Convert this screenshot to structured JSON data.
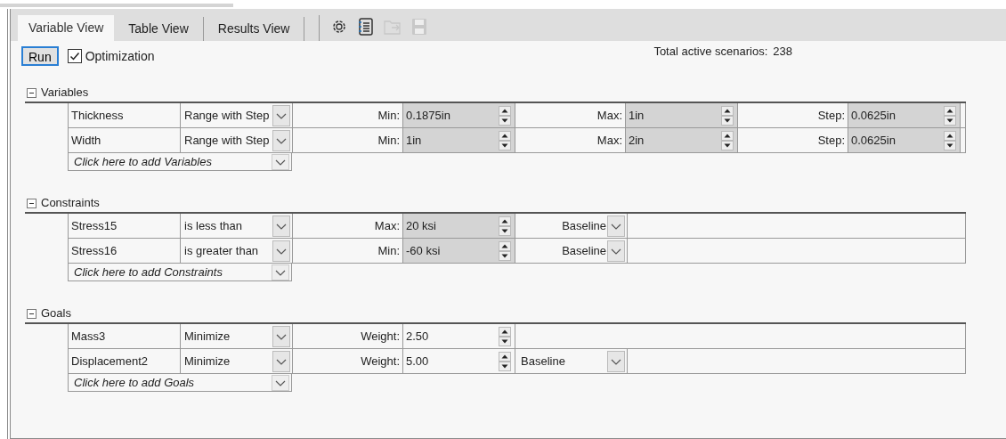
{
  "tabs": [
    {
      "label": "Variable View",
      "selected": true
    },
    {
      "label": "Table View",
      "selected": false
    },
    {
      "label": "Results View",
      "selected": false
    }
  ],
  "toolbar": [
    {
      "kind": "settings",
      "disabled": false
    },
    {
      "kind": "notebook",
      "disabled": false
    },
    {
      "kind": "folder",
      "disabled": true
    },
    {
      "kind": "save",
      "disabled": true
    }
  ],
  "run_button": {
    "label": "Run",
    "focused": true
  },
  "optimization": {
    "label": "Optimization",
    "checked": true
  },
  "total": {
    "label": "Total active scenarios:",
    "value": "238"
  },
  "sections": [
    {
      "title": "Variables",
      "expanded": true,
      "add_row": "Click here to add Variables",
      "rows": [
        {
          "name": "Thickness",
          "condition": "Range with Step",
          "fields": [
            {
              "kind": "spinner",
              "label": "Min:",
              "value": "0.1875in",
              "shaded": true
            },
            {
              "kind": "spinner",
              "label": "Max:",
              "value": "1in",
              "shaded": true
            },
            {
              "kind": "spinner",
              "label": "Step:",
              "value": "0.0625in",
              "shaded": true
            }
          ]
        },
        {
          "name": "Width",
          "condition": "Range with Step",
          "fields": [
            {
              "kind": "spinner",
              "label": "Min:",
              "value": "1in",
              "shaded": true
            },
            {
              "kind": "spinner",
              "label": "Max:",
              "value": "2in",
              "shaded": true
            },
            {
              "kind": "spinner",
              "label": "Step:",
              "value": "0.0625in",
              "shaded": true
            }
          ]
        }
      ]
    },
    {
      "title": "Constraints",
      "expanded": true,
      "add_row": "Click here to add Constraints",
      "rows": [
        {
          "name": "Stress15",
          "condition": "is less than",
          "fields": [
            {
              "kind": "spinner",
              "label": "Max:",
              "value": "20 ksi",
              "shaded": true
            },
            {
              "kind": "picker",
              "value": "Baseline"
            }
          ]
        },
        {
          "name": "Stress16",
          "condition": "is greater than",
          "fields": [
            {
              "kind": "spinner",
              "label": "Min:",
              "value": "-60 ksi",
              "shaded": true
            },
            {
              "kind": "picker",
              "value": "Baseline"
            }
          ]
        }
      ]
    },
    {
      "title": "Goals",
      "expanded": true,
      "add_row": "Click here to add Goals",
      "rows": [
        {
          "name": "Mass3",
          "condition": "Minimize",
          "fields": [
            {
              "kind": "spinner",
              "label": "Weight:",
              "value": "2.50",
              "shaded": false
            }
          ]
        },
        {
          "name": "Displacement2",
          "condition": "Minimize",
          "fields": [
            {
              "kind": "spinner",
              "label": "Weight:",
              "value": "5.00",
              "shaded": false
            },
            {
              "kind": "dropdown",
              "value": "Baseline"
            }
          ]
        }
      ]
    }
  ]
}
